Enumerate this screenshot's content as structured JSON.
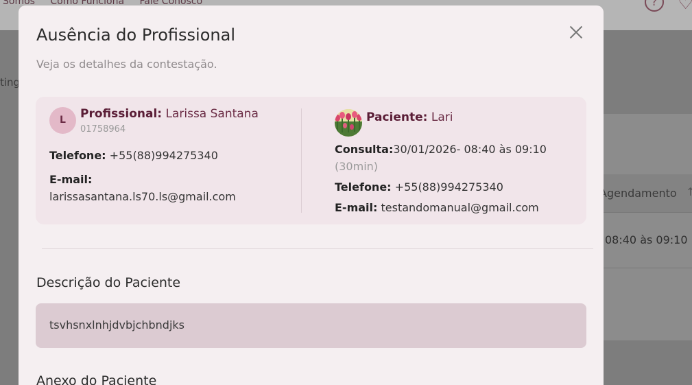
{
  "background": {
    "nav_links": [
      "Somos",
      "Como Funciona",
      "Fale Conosco"
    ],
    "help_icon_glyph": "?",
    "left_text": "ting",
    "table": {
      "header_label": "Agendamento",
      "cell_value": "08:40 às 09:10"
    }
  },
  "modal": {
    "title": "Ausência do Profissional",
    "subtitle": "Veja os detalhes da contestação.",
    "professional": {
      "avatar_letter": "L",
      "label": "Profissional:",
      "name": "Larissa Santana",
      "registration": "01758964",
      "phone_label": "Telefone:",
      "phone": "+55(88)994275340",
      "email_label": "E-mail:",
      "email": "larissasantana.ls70.ls@gmail.com"
    },
    "patient": {
      "label": "Paciente:",
      "name": "Lari",
      "consult_label": "Consulta:",
      "consult": "30/01/2026- 08:40 às 09:10",
      "duration": "(30min)",
      "phone_label": "Telefone:",
      "phone": "+55(88)994275340",
      "email_label": "E-mail:",
      "email": "testandomanual@gmail.com"
    },
    "description_title": "Descrição do Paciente",
    "description_text": "tsvhsnxlnhjdvbjchbndjks",
    "attachment_title": "Anexo do Paciente"
  },
  "colors": {
    "accent": "#6b2c45",
    "modal_bg": "#f5eff1",
    "card_bg": "#f1e5ea",
    "description_bg": "#dccbd2"
  }
}
